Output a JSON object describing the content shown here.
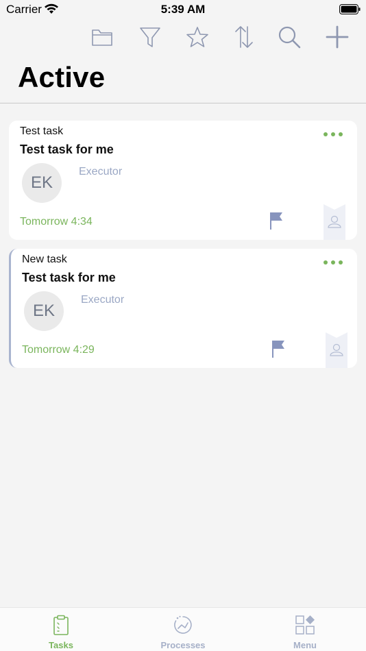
{
  "status": {
    "carrier": "Carrier",
    "time": "5:39 AM"
  },
  "toolbar": {
    "icons": [
      "folder-icon",
      "filter-icon",
      "star-icon",
      "sort-icon",
      "search-icon",
      "plus-icon"
    ],
    "icon_color": "#8e97b0",
    "add_color": "#8e97b0"
  },
  "page": {
    "title": "Active"
  },
  "tasks": [
    {
      "type": "Test task",
      "title": "Test task for me",
      "initials": "EK",
      "role": "Executor",
      "due": "Tomorrow 4:34"
    },
    {
      "type": "New task",
      "title": "Test task for me",
      "initials": "EK",
      "role": "Executor",
      "due": "Tomorrow 4:29"
    }
  ],
  "colors": {
    "accent_green": "#7ab55c",
    "muted_blue": "#9aa7c4",
    "flag": "#8794bd"
  },
  "tabbar": {
    "tabs": [
      {
        "label": "Tasks",
        "icon": "clipboard-icon",
        "active": true,
        "color": "#7ab55c"
      },
      {
        "label": "Processes",
        "icon": "processes-icon",
        "active": false,
        "color": "#a6b0c8"
      },
      {
        "label": "Menu",
        "icon": "grid-menu-icon",
        "active": false,
        "color": "#a6b0c8"
      }
    ]
  }
}
